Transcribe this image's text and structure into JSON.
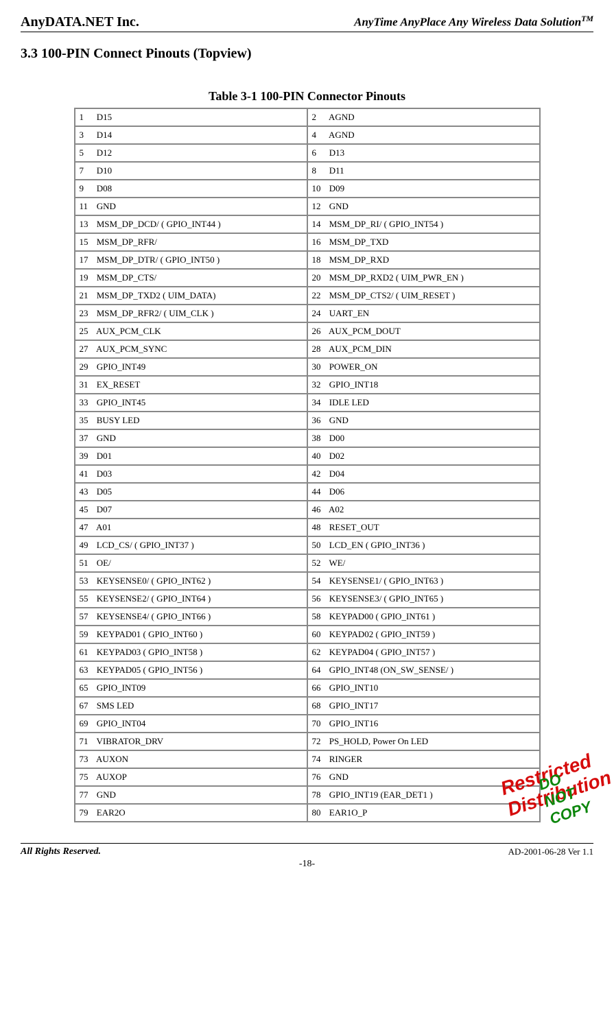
{
  "header": {
    "left": "AnyDATA.NET Inc.",
    "right_main": "AnyTime AnyPlace Any Wireless Data Solution",
    "right_sup": "TM"
  },
  "section_heading": "3.3 100-PIN Connect Pinouts (Topview)",
  "table_caption": "Table 3-1 100-PIN Connector Pinouts",
  "rows": [
    {
      "ln": "1",
      "lname": "D15",
      "rn": "2",
      "rname": "AGND"
    },
    {
      "ln": "3",
      "lname": "D14",
      "rn": "4",
      "rname": "AGND"
    },
    {
      "ln": "5",
      "lname": "D12",
      "rn": "6",
      "rname": "D13"
    },
    {
      "ln": "7",
      "lname": "D10",
      "rn": "8",
      "rname": "D11"
    },
    {
      "ln": "9",
      "lname": "D08",
      "rn": "10",
      "rname": "D09"
    },
    {
      "ln": "11",
      "lname": "GND",
      "rn": "12",
      "rname": "GND"
    },
    {
      "ln": "13",
      "lname": "MSM_DP_DCD/ ( GPIO_INT44 )",
      "rn": "14",
      "rname": "MSM_DP_RI/ ( GPIO_INT54 )"
    },
    {
      "ln": "15",
      "lname": "MSM_DP_RFR/",
      "rn": "16",
      "rname": "MSM_DP_TXD"
    },
    {
      "ln": "17",
      "lname": "MSM_DP_DTR/ ( GPIO_INT50 )",
      "rn": "18",
      "rname": "MSM_DP_RXD"
    },
    {
      "ln": "19",
      "lname": "MSM_DP_CTS/",
      "rn": "20",
      "rname": "MSM_DP_RXD2 ( UIM_PWR_EN )"
    },
    {
      "ln": "21",
      "lname": "MSM_DP_TXD2 ( UIM_DATA)",
      "rn": "22",
      "rname": "MSM_DP_CTS2/ ( UIM_RESET )"
    },
    {
      "ln": "23",
      "lname": "MSM_DP_RFR2/ ( UIM_CLK )",
      "rn": "24",
      "rname": "UART_EN"
    },
    {
      "ln": "25",
      "lname": "AUX_PCM_CLK",
      "rn": "26",
      "rname": "AUX_PCM_DOUT"
    },
    {
      "ln": "27",
      "lname": "AUX_PCM_SYNC",
      "rn": "28",
      "rname": "AUX_PCM_DIN"
    },
    {
      "ln": "29",
      "lname": "GPIO_INT49",
      "rn": "30",
      "rname": "POWER_ON"
    },
    {
      "ln": "31",
      "lname": "EX_RESET",
      "rn": "32",
      "rname": "GPIO_INT18"
    },
    {
      "ln": "33",
      "lname": "GPIO_INT45",
      "rn": "34",
      "rname": "IDLE LED"
    },
    {
      "ln": "35",
      "lname": "BUSY LED",
      "rn": "36",
      "rname": "GND"
    },
    {
      "ln": "37",
      "lname": "GND",
      "rn": "38",
      "rname": "D00"
    },
    {
      "ln": "39",
      "lname": "D01",
      "rn": "40",
      "rname": "D02"
    },
    {
      "ln": "41",
      "lname": "D03",
      "rn": "42",
      "rname": "D04"
    },
    {
      "ln": "43",
      "lname": "D05",
      "rn": "44",
      "rname": "D06"
    },
    {
      "ln": "45",
      "lname": "D07",
      "rn": "46",
      "rname": "A02"
    },
    {
      "ln": "47",
      "lname": "A01",
      "rn": "48",
      "rname": "RESET_OUT"
    },
    {
      "ln": "49",
      "lname": "LCD_CS/ ( GPIO_INT37 )",
      "rn": "50",
      "rname": "LCD_EN ( GPIO_INT36 )"
    },
    {
      "ln": "51",
      "lname": "OE/",
      "rn": "52",
      "rname": "WE/"
    },
    {
      "ln": "53",
      "lname": "KEYSENSE0/ ( GPIO_INT62 )",
      "rn": "54",
      "rname": "KEYSENSE1/ ( GPIO_INT63 )"
    },
    {
      "ln": "55",
      "lname": "KEYSENSE2/ ( GPIO_INT64 )",
      "rn": "56",
      "rname": "KEYSENSE3/ ( GPIO_INT65 )"
    },
    {
      "ln": "57",
      "lname": "KEYSENSE4/ ( GPIO_INT66 )",
      "rn": "58",
      "rname": "KEYPAD00 ( GPIO_INT61 )"
    },
    {
      "ln": "59",
      "lname": "KEYPAD01 ( GPIO_INT60 )",
      "rn": "60",
      "rname": "KEYPAD02 ( GPIO_INT59 )"
    },
    {
      "ln": "61",
      "lname": "KEYPAD03 ( GPIO_INT58 )",
      "rn": "62",
      "rname": "KEYPAD04 ( GPIO_INT57 )"
    },
    {
      "ln": "63",
      "lname": "KEYPAD05 ( GPIO_INT56 )",
      "rn": "64",
      "rname": "GPIO_INT48 (ON_SW_SENSE/ )"
    },
    {
      "ln": "65",
      "lname": "GPIO_INT09",
      "rn": "66",
      "rname": "GPIO_INT10"
    },
    {
      "ln": "67",
      "lname": "SMS LED",
      "rn": "68",
      "rname": "GPIO_INT17"
    },
    {
      "ln": "69",
      "lname": "GPIO_INT04",
      "rn": "70",
      "rname": "GPIO_INT16"
    },
    {
      "ln": "71",
      "lname": "VIBRATOR_DRV",
      "rn": "72",
      "rname": "PS_HOLD, Power On LED"
    },
    {
      "ln": "73",
      "lname": "AUXON",
      "rn": "74",
      "rname": "RINGER"
    },
    {
      "ln": "75",
      "lname": "AUXOP",
      "rn": "76",
      "rname": "GND"
    },
    {
      "ln": "77",
      "lname": "GND",
      "rn": "78",
      "rname": "GPIO_INT19 (EAR_DET1 )"
    },
    {
      "ln": "79",
      "lname": "EAR2O",
      "rn": "80",
      "rname": "EAR1O_P"
    }
  ],
  "footer": {
    "left": "All Rights Reserved.",
    "right": "AD-2001-06-28 Ver 1.1"
  },
  "page_number": "-18-",
  "watermark": {
    "line1": "Restricted Distribution",
    "line2": "DO NOT COPY"
  }
}
